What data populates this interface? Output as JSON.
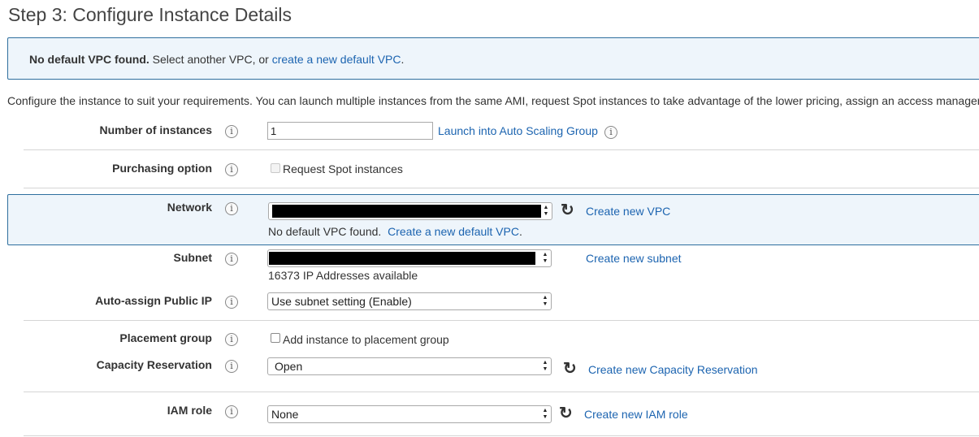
{
  "page": {
    "title": "Step 3: Configure Instance Details"
  },
  "alert": {
    "bold": "No default VPC found.",
    "text": " Select another VPC, or ",
    "link": "create a new default VPC",
    "suffix": "."
  },
  "description": "Configure the instance to suit your requirements. You can launch multiple instances from the same AMI, request Spot instances to take advantage of the lower pricing, assign an access managem",
  "fields": {
    "instances": {
      "label": "Number of instances",
      "value": "1",
      "link": "Launch into Auto Scaling Group"
    },
    "purchasing": {
      "label": "Purchasing option",
      "checkbox_label": "Request Spot instances",
      "checked": false
    },
    "network": {
      "label": "Network",
      "value": "",
      "create_link": "Create new VPC",
      "note": "No default VPC found.",
      "note_link": "Create a new default VPC",
      "note_suffix": "."
    },
    "subnet": {
      "label": "Subnet",
      "value": "",
      "create_link": "Create new subnet",
      "help": "16373 IP Addresses available"
    },
    "public_ip": {
      "label": "Auto-assign Public IP",
      "value": "Use subnet setting (Enable)"
    },
    "placement": {
      "label": "Placement group",
      "checkbox_label": "Add instance to placement group",
      "checked": false
    },
    "capacity": {
      "label": "Capacity Reservation",
      "value": "Open",
      "create_link": "Create new Capacity Reservation"
    },
    "iam": {
      "label": "IAM role",
      "value": "None",
      "create_link": "Create new IAM role"
    }
  },
  "icons": {
    "info": "info-icon",
    "refresh": "refresh-icon",
    "select_arrows": "select-arrows-icon"
  },
  "colors": {
    "link": "#1c64b0",
    "alert_border": "#2e6f9e",
    "alert_bg": "#eef5fb",
    "text": "#333333"
  }
}
